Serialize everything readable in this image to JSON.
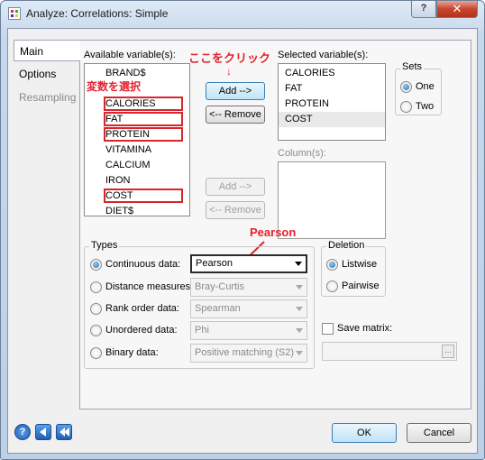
{
  "window": {
    "title": "Analyze: Correlations: Simple",
    "help_glyph": "?",
    "close_glyph": "✕"
  },
  "tabs": [
    {
      "label": "Main",
      "active": true
    },
    {
      "label": "Options",
      "active": false
    },
    {
      "label": "Resampling",
      "disabled": true
    }
  ],
  "available": {
    "label": "Available variable(s):",
    "items": [
      "BRAND$",
      "CALORIES",
      "FAT",
      "PROTEIN",
      "VITAMINA",
      "CALCIUM",
      "IRON",
      "COST",
      "DIET$"
    ]
  },
  "selected": {
    "label": "Selected variable(s):",
    "items": [
      "CALORIES",
      "FAT",
      "PROTEIN",
      "COST"
    ]
  },
  "columns": {
    "label": "Column(s):"
  },
  "buttons": {
    "add": "Add -->",
    "remove": "<-- Remove",
    "add2": "Add -->",
    "remove2": "<-- Remove",
    "ok": "OK",
    "cancel": "Cancel"
  },
  "sets": {
    "title": "Sets",
    "one": "One",
    "two": "Two",
    "selected": "One"
  },
  "types": {
    "title": "Types",
    "rows": [
      {
        "label": "Continuous data:",
        "value": "Pearson",
        "selected": true
      },
      {
        "label": "Distance measures:",
        "value": "Bray-Curtis",
        "selected": false
      },
      {
        "label": "Rank order data:",
        "value": "Spearman",
        "selected": false
      },
      {
        "label": "Unordered data:",
        "value": "Phi",
        "selected": false
      },
      {
        "label": "Binary data:",
        "value": "Positive matching (S2)",
        "selected": false
      }
    ]
  },
  "deletion": {
    "title": "Deletion",
    "listwise": "Listwise",
    "pairwise": "Pairwise",
    "selected": "Listwise"
  },
  "save_matrix": {
    "label": "Save matrix:",
    "checked": false,
    "browse_glyph": "..."
  },
  "annotations": {
    "click_here": "ここをクリック",
    "arrow_down": "↓",
    "select_vars": "変数を選択",
    "pearson": "Pearson"
  },
  "colors": {
    "annotation": "#e3222d",
    "title_gradient_top": "#dfeaf6"
  }
}
